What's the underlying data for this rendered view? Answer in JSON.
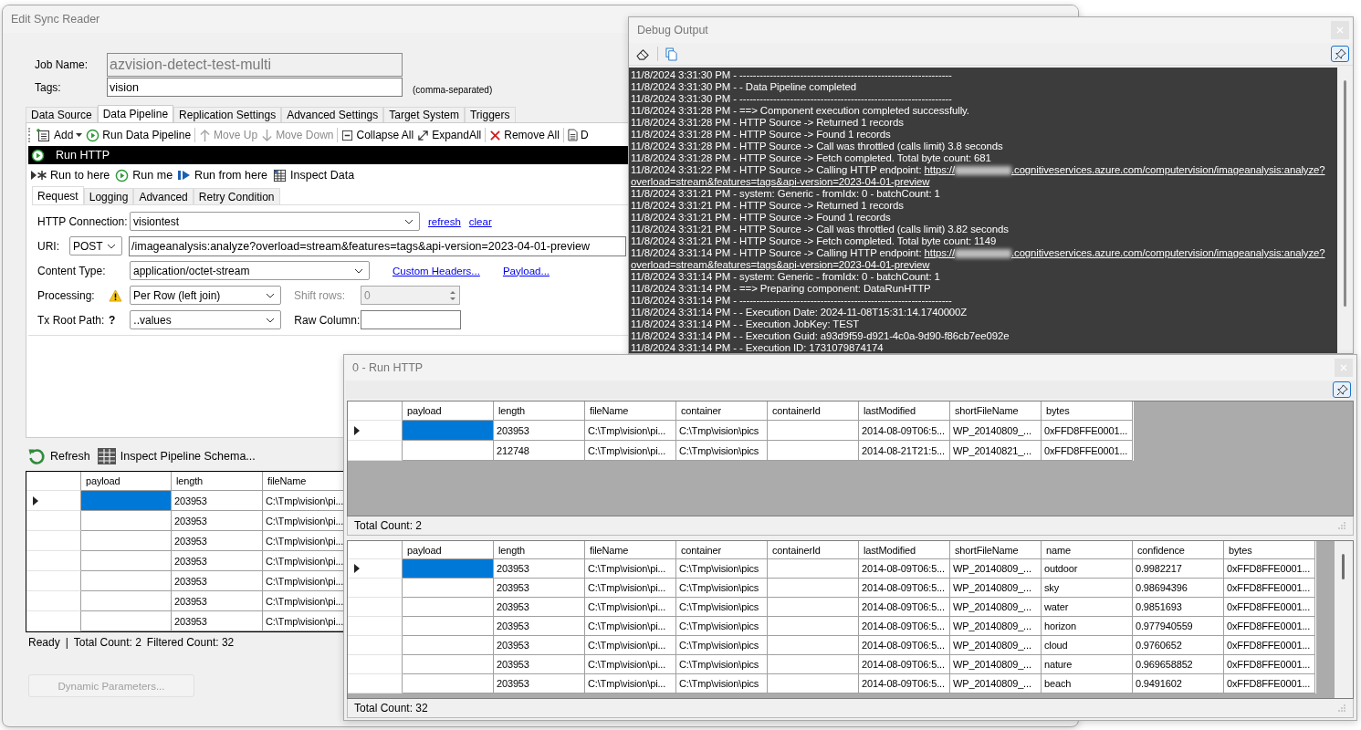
{
  "main_window": {
    "title": "Edit Sync Reader",
    "job_name": {
      "label": "Job Name:",
      "value": "azvision-detect-test-multi",
      "disabled": true
    },
    "tags": {
      "label": "Tags:",
      "value": "vision",
      "hint": "(comma-separated)"
    },
    "tabs": [
      {
        "label": "Data Source",
        "selected": false
      },
      {
        "label": "Data Pipeline",
        "selected": true
      },
      {
        "label": "Replication Settings",
        "selected": false
      },
      {
        "label": "Advanced Settings",
        "selected": false
      },
      {
        "label": "Target System",
        "selected": false
      },
      {
        "label": "Triggers",
        "selected": false
      }
    ],
    "toolbar": [
      {
        "label": "Add",
        "dropdown": true,
        "disabled": false
      },
      {
        "label": "Run Data Pipeline",
        "dropdown": false,
        "disabled": false
      },
      {
        "label": "Move Up",
        "dropdown": false,
        "disabled": true
      },
      {
        "label": "Move Down",
        "dropdown": false,
        "disabled": true
      },
      {
        "label": "Collapse All",
        "dropdown": false,
        "disabled": false
      },
      {
        "label": "ExpandAll",
        "dropdown": false,
        "disabled": false
      },
      {
        "label": "Remove All",
        "dropdown": false,
        "disabled": false
      },
      {
        "label": "D",
        "dropdown": false,
        "disabled": false
      }
    ],
    "pipeline_step": {
      "title": "Run HTTP"
    },
    "step_toolbar": [
      {
        "label": "Run to here"
      },
      {
        "label": "Run me"
      },
      {
        "label": "Run from here"
      },
      {
        "label": "Inspect Data"
      }
    ],
    "sub_tabs": [
      {
        "label": "Request",
        "selected": true
      },
      {
        "label": "Logging",
        "selected": false
      },
      {
        "label": "Advanced",
        "selected": false
      },
      {
        "label": "Retry Condition",
        "selected": false
      }
    ],
    "request": {
      "http_connection": {
        "label": "HTTP Connection:",
        "value": "visiontest"
      },
      "connection_links": [
        "refresh",
        "clear"
      ],
      "uri": {
        "label": "URI:",
        "method": "POST",
        "value": "/imageanalysis:analyze?overload=stream&features=tags&api-version=2023-04-01-preview"
      },
      "content_type": {
        "label": "Content Type:",
        "value": "application/octet-stream"
      },
      "content_links": [
        "Custom Headers...",
        "Payload..."
      ],
      "processing": {
        "label": "Processing:",
        "value": "Per Row (left join)",
        "warning": true
      },
      "shift_rows": {
        "label": "Shift rows:",
        "value": "0",
        "disabled": true
      },
      "tx_root_path": {
        "label": "Tx Root Path:",
        "help": "?",
        "value": "..values"
      },
      "raw_column": {
        "label": "Raw Column:"
      }
    },
    "preview_toolbar": [
      {
        "label": "Refresh"
      },
      {
        "label": "Inspect Pipeline Schema..."
      }
    ],
    "preview_grid": {
      "columns": [
        "payload",
        "length",
        "fileName"
      ],
      "rows": [
        {
          "selected": true,
          "cells": [
            null,
            "203953",
            "C:\\Tmp\\vision\\pi..."
          ]
        },
        {
          "selected": false,
          "cells": [
            null,
            "203953",
            "C:\\Tmp\\vision\\pi..."
          ]
        },
        {
          "selected": false,
          "cells": [
            null,
            "203953",
            "C:\\Tmp\\vision\\pi..."
          ]
        },
        {
          "selected": false,
          "cells": [
            null,
            "203953",
            "C:\\Tmp\\vision\\pi..."
          ]
        },
        {
          "selected": false,
          "cells": [
            null,
            "203953",
            "C:\\Tmp\\vision\\pi..."
          ]
        },
        {
          "selected": false,
          "cells": [
            null,
            "203953",
            "C:\\Tmp\\vision\\pi..."
          ]
        },
        {
          "selected": false,
          "cells": [
            null,
            "203953",
            "C:\\Tmp\\vision\\pi..."
          ]
        }
      ]
    },
    "status": {
      "state": "Ready",
      "separator": "|",
      "total": "Total Count: 2",
      "filtered": "Filtered Count: 32"
    },
    "dynamic_parameters": {
      "label": "Dynamic Parameters...",
      "disabled": true
    }
  },
  "debug_window": {
    "title": "Debug Output",
    "lines": [
      {
        "text": "11/8/2024 3:31:30 PM - ---------------------------------------------------------------"
      },
      {
        "text": "11/8/2024 3:31:30 PM - - Data Pipeline completed"
      },
      {
        "text": "11/8/2024 3:31:30 PM - ---------------------------------------------------------------"
      },
      {
        "text": "11/8/2024 3:31:28 PM - ==> Component execution completed successfully."
      },
      {
        "text": "11/8/2024 3:31:28 PM - HTTP Source -> Returned 1 records"
      },
      {
        "text": "11/8/2024 3:31:28 PM - HTTP Source -> Found 1 records"
      },
      {
        "text": "11/8/2024 3:31:28 PM - HTTP Source -> Call was throttled (calls limit) 3.8 seconds"
      },
      {
        "text": "11/8/2024 3:31:28 PM - HTTP Source -> Fetch completed. Total byte count: 681"
      },
      {
        "text": "11/8/2024 3:31:22 PM - HTTP Source -> Calling HTTP endpoint:",
        "link": {
          "scheme": "https://",
          "rest": ".cognitiveservices.azure.com/computervision/imageanalysis:analyze?",
          "continuation": "overload=stream&features=tags&api-version=2023-04-01-preview"
        }
      },
      {
        "text": "11/8/2024 3:31:21 PM - system: Generic - fromIdx: 0 - batchCount: 1"
      },
      {
        "text": "11/8/2024 3:31:21 PM - HTTP Source -> Returned 1 records"
      },
      {
        "text": "11/8/2024 3:31:21 PM - HTTP Source -> Found 1 records"
      },
      {
        "text": "11/8/2024 3:31:21 PM - HTTP Source -> Call was throttled (calls limit) 3.82 seconds"
      },
      {
        "text": "11/8/2024 3:31:21 PM - HTTP Source -> Fetch completed. Total byte count: 1149"
      },
      {
        "text": "11/8/2024 3:31:14 PM - HTTP Source -> Calling HTTP endpoint:",
        "link": {
          "scheme": "https://",
          "rest": ".cognitiveservices.azure.com/computervision/imageanalysis:analyze?",
          "continuation": "overload=stream&features=tags&api-version=2023-04-01-preview"
        }
      },
      {
        "text": "11/8/2024 3:31:14 PM - system: Generic - fromIdx: 0 - batchCount: 1"
      },
      {
        "text": "11/8/2024 3:31:14 PM - ==> Preparing component: DataRunHTTP"
      },
      {
        "text": "11/8/2024 3:31:14 PM - ---------------------------------------------------------------"
      },
      {
        "text": "11/8/2024 3:31:14 PM - - Execution Date: 2024-11-08T15:31:14.1740000Z"
      },
      {
        "text": "11/8/2024 3:31:14 PM - - Execution JobKey: TEST"
      },
      {
        "text": "11/8/2024 3:31:14 PM - - Execution Guid: a93d9f59-d921-4c0a-9d90-f86cb7ee092e"
      },
      {
        "text": "11/8/2024 3:31:14 PM - - Execution ID: 1731079874174"
      }
    ]
  },
  "run_window": {
    "title": "0 - Run HTTP",
    "source_grid": {
      "columns": [
        "payload",
        "length",
        "fileName",
        "container",
        "containerId",
        "lastModified",
        "shortFileName",
        "bytes"
      ],
      "rows": [
        {
          "selected": true,
          "cells": [
            null,
            "203953",
            "C:\\Tmp\\vision\\pi...",
            "C:\\Tmp\\vision\\pics",
            null,
            "2014-08-09T06:5...",
            "WP_20140809_...",
            "0xFFD8FFE0001..."
          ]
        },
        {
          "selected": false,
          "cells": [
            null,
            "212748",
            "C:\\Tmp\\vision\\pi...",
            "C:\\Tmp\\vision\\pics",
            null,
            "2014-08-21T21:5...",
            "WP_20140821_...",
            "0xFFD8FFE0001..."
          ]
        }
      ]
    },
    "source_status": "Total Count: 2",
    "result_grid": {
      "columns": [
        "payload",
        "length",
        "fileName",
        "container",
        "containerId",
        "lastModified",
        "shortFileName",
        "name",
        "confidence",
        "bytes"
      ],
      "rows": [
        {
          "selected": true,
          "cells": [
            null,
            "203953",
            "C:\\Tmp\\vision\\pi...",
            "C:\\Tmp\\vision\\pics",
            null,
            "2014-08-09T06:5...",
            "WP_20140809_...",
            "outdoor",
            "0.9982217",
            "0xFFD8FFE0001..."
          ]
        },
        {
          "selected": false,
          "cells": [
            null,
            "203953",
            "C:\\Tmp\\vision\\pi...",
            "C:\\Tmp\\vision\\pics",
            null,
            "2014-08-09T06:5...",
            "WP_20140809_...",
            "sky",
            "0.98694396",
            "0xFFD8FFE0001..."
          ]
        },
        {
          "selected": false,
          "cells": [
            null,
            "203953",
            "C:\\Tmp\\vision\\pi...",
            "C:\\Tmp\\vision\\pics",
            null,
            "2014-08-09T06:5...",
            "WP_20140809_...",
            "water",
            "0.9851693",
            "0xFFD8FFE0001..."
          ]
        },
        {
          "selected": false,
          "cells": [
            null,
            "203953",
            "C:\\Tmp\\vision\\pi...",
            "C:\\Tmp\\vision\\pics",
            null,
            "2014-08-09T06:5...",
            "WP_20140809_...",
            "horizon",
            "0.977940559",
            "0xFFD8FFE0001..."
          ]
        },
        {
          "selected": false,
          "cells": [
            null,
            "203953",
            "C:\\Tmp\\vision\\pi...",
            "C:\\Tmp\\vision\\pics",
            null,
            "2014-08-09T06:5...",
            "WP_20140809_...",
            "cloud",
            "0.9760652",
            "0xFFD8FFE0001..."
          ]
        },
        {
          "selected": false,
          "cells": [
            null,
            "203953",
            "C:\\Tmp\\vision\\pi...",
            "C:\\Tmp\\vision\\pics",
            null,
            "2014-08-09T06:5...",
            "WP_20140809_...",
            "nature",
            "0.969658852",
            "0xFFD8FFE0001..."
          ]
        },
        {
          "selected": false,
          "cells": [
            null,
            "203953",
            "C:\\Tmp\\vision\\pi...",
            "C:\\Tmp\\vision\\pics",
            null,
            "2014-08-09T06:5...",
            "WP_20140809_...",
            "beach",
            "0.9491602",
            "0xFFD8FFE0001..."
          ]
        }
      ]
    },
    "result_status": "Total Count: 32"
  }
}
